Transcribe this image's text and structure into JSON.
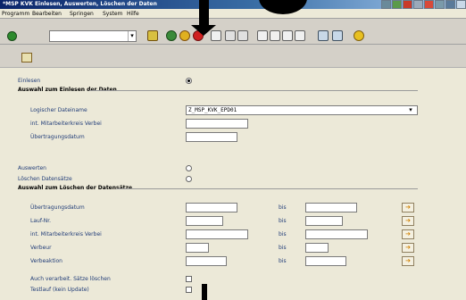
{
  "window": {
    "title": "*MSP KVK Einlesen, Auswerten, Löschen der Daten"
  },
  "menu": [
    {
      "label": "Programm"
    },
    {
      "label": "Bearbeiten"
    },
    {
      "label": "Springen"
    },
    {
      "label": "System"
    },
    {
      "label": "Hilfe"
    }
  ],
  "toolbar": {
    "command_value": "",
    "dropdown_glyph": "▾",
    "icons": [
      "enter-icon",
      "save-icon",
      "back-icon",
      "exit-icon",
      "cancel-icon",
      "print-icon",
      "find-icon",
      "find-next-icon",
      "first-page-icon",
      "prev-page-icon",
      "next-page-icon",
      "last-page-icon",
      "new-session-icon",
      "shortcut-icon",
      "help-icon"
    ]
  },
  "form": {
    "einlesen_label": "Einlesen",
    "section_einlesen": "Auswahl zum Einlesen der Daten",
    "logischer_dateiname_label": "Logischer Dateiname",
    "logischer_dateiname_value": "Z_MSP_KVK_EPD01",
    "mitarbeiterkreis_label": "int. Mitarbeiterkreis Verbei",
    "uebertragungsdatum_label": "Übertragungsdatum",
    "auswerten_label": "Auswerten",
    "loeschen_label": "Löschen Datensätze",
    "section_loeschen": "Auswahl zum Löschen der Datensätze",
    "rows": [
      {
        "label": "Übertragungsdatum",
        "bis": "bis"
      },
      {
        "label": "Lauf-Nr.",
        "bis": "bis"
      },
      {
        "label": "int. Mitarbeiterkreis Verbei",
        "bis": "bis"
      },
      {
        "label": "Verbeur",
        "bis": "bis"
      },
      {
        "label": "Verbeaktion",
        "bis": "bis"
      }
    ],
    "auch_label": "Auch verarbeit. Sätze löschen",
    "testlauf_label": "Testlauf (kein Update)"
  }
}
